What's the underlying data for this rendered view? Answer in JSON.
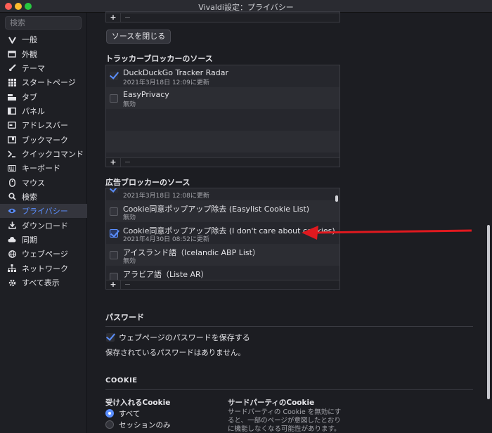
{
  "window": {
    "title": "Vivaldi設定：プライバシー"
  },
  "sidebar": {
    "search_placeholder": "検索",
    "items": [
      {
        "label": "一般",
        "icon": "vivaldi-icon"
      },
      {
        "label": "外観",
        "icon": "folder-icon"
      },
      {
        "label": "テーマ",
        "icon": "brush-icon"
      },
      {
        "label": "スタートページ",
        "icon": "grid-icon"
      },
      {
        "label": "タブ",
        "icon": "tabs-icon"
      },
      {
        "label": "パネル",
        "icon": "panel-icon"
      },
      {
        "label": "アドレスバー",
        "icon": "address-bar-icon"
      },
      {
        "label": "ブックマーク",
        "icon": "bookmark-icon"
      },
      {
        "label": "クイックコマンド",
        "icon": "quick-command-icon"
      },
      {
        "label": "キーボード",
        "icon": "keyboard-icon"
      },
      {
        "label": "マウス",
        "icon": "mouse-icon"
      },
      {
        "label": "検索",
        "icon": "search-icon"
      },
      {
        "label": "プライバシー",
        "icon": "eye-icon",
        "active": true
      },
      {
        "label": "ダウンロード",
        "icon": "download-icon"
      },
      {
        "label": "同期",
        "icon": "cloud-icon"
      },
      {
        "label": "ウェブページ",
        "icon": "globe-icon"
      },
      {
        "label": "ネットワーク",
        "icon": "network-icon"
      },
      {
        "label": "すべて表示",
        "icon": "gear-icon"
      }
    ]
  },
  "main": {
    "top_list": {
      "plus": "+",
      "minus": "−"
    },
    "close_sources_button": "ソースを閉じる",
    "tracker": {
      "title": "トラッカーブロッカーのソース",
      "items": [
        {
          "name": "DuckDuckGo Tracker Radar",
          "status": "2021年3月18日 12:09に更新",
          "checked": true
        },
        {
          "name": "EasyPrivacy",
          "status": "無効",
          "checked": false
        }
      ],
      "plus": "+",
      "minus": "−"
    },
    "adblock": {
      "title": "広告ブロッカーのソース",
      "items": [
        {
          "name": "",
          "status": "2021年3月18日 12:08に更新",
          "checked": true
        },
        {
          "name": "Cookie同意ポップアップ除去 (Easylist Cookie List)",
          "status": "無効",
          "checked": false
        },
        {
          "name": "Cookie同意ポップアップ除去 (I don't care about cookies)",
          "status": "2021年4月30日 08:52に更新",
          "checked": true
        },
        {
          "name": "アイスランド語（Icelandic ABP List）",
          "status": "無効",
          "checked": false
        },
        {
          "name": "アラビア語（Liste AR）",
          "status": "",
          "checked": false
        }
      ],
      "plus": "+",
      "minus": "−"
    },
    "password": {
      "title": "パスワード",
      "save_label": "ウェブページのパスワードを保存する",
      "save_checked": true,
      "none_saved": "保存されているパスワードはありません。"
    },
    "cookie": {
      "title": "COOKIE",
      "accept_title": "受け入れるCookie",
      "options": [
        "すべて",
        "セッションのみ"
      ],
      "selected": "すべて",
      "third_party_title": "サードパーティのCookie",
      "third_party_desc": "サードパーティの Cookie を無効にすると、一部のページが意図したとおりに機能しなくなる可能性があります。"
    }
  },
  "colors": {
    "accent": "#5b8fff",
    "annotation_arrow": "#e0191f"
  }
}
